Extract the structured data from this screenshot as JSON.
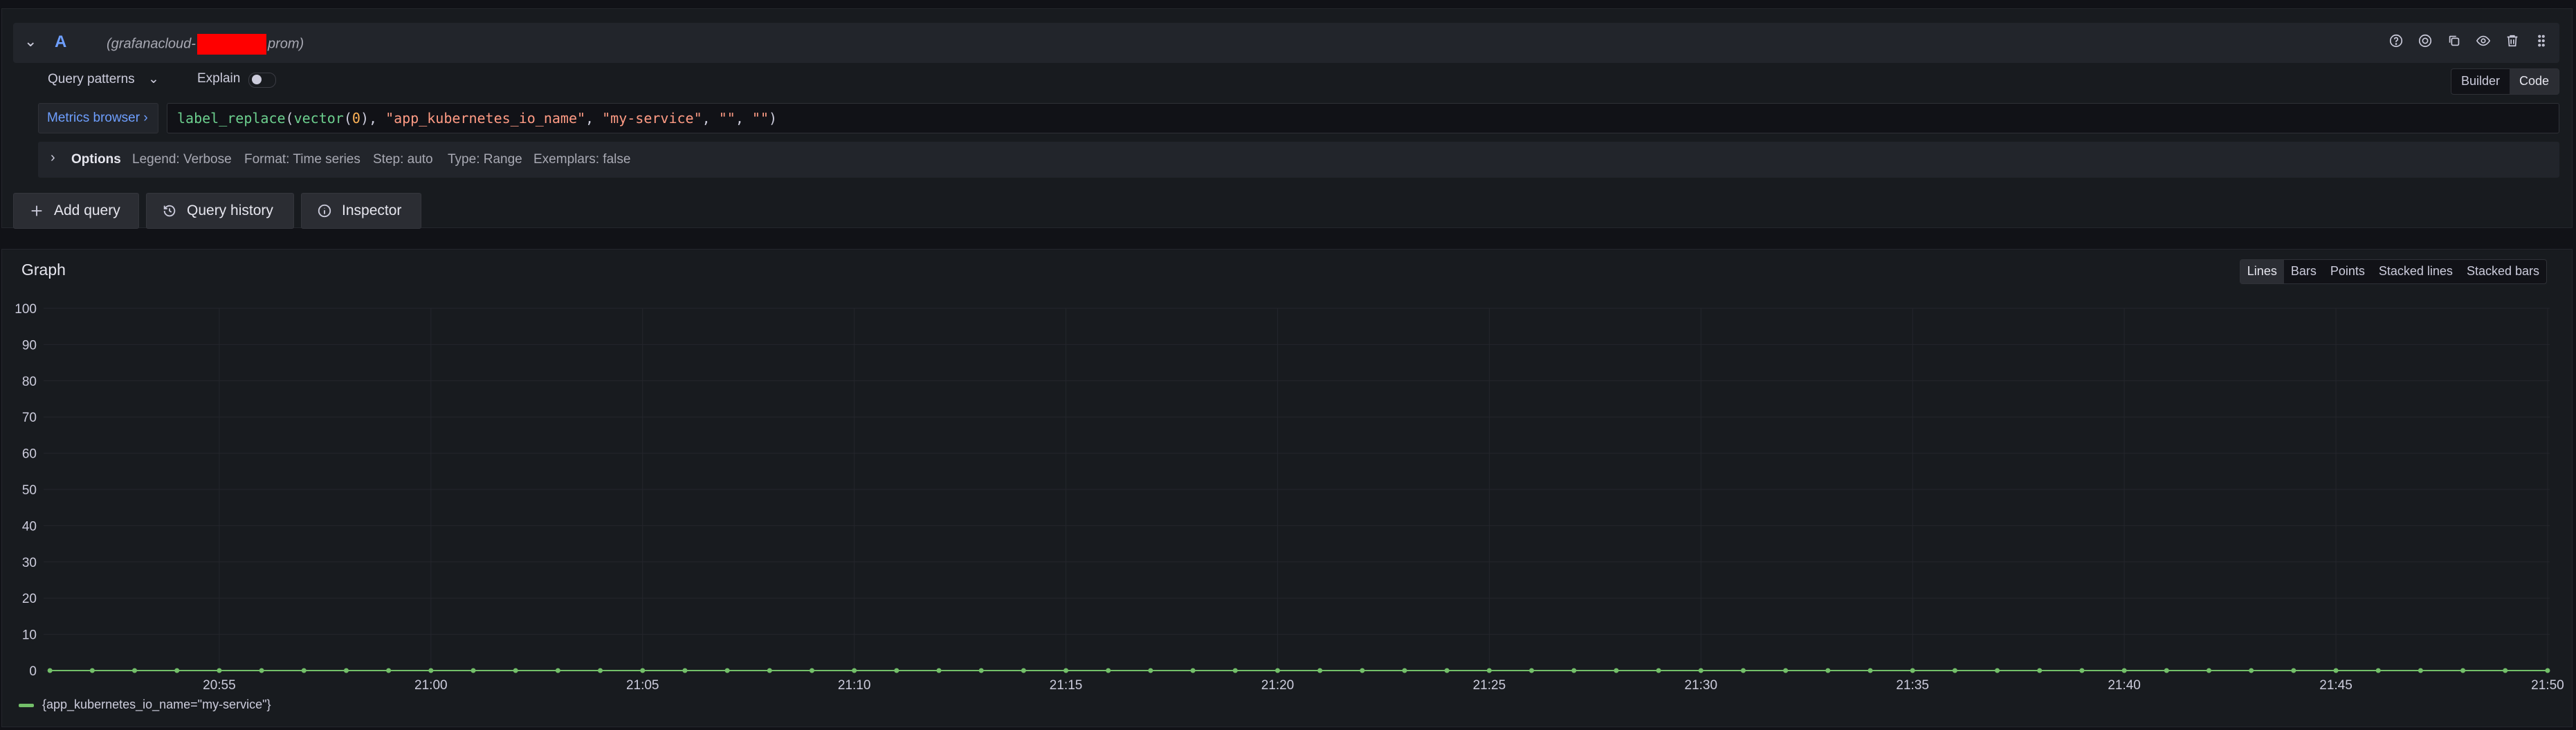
{
  "query": {
    "ref_id": "A",
    "datasource_prefix": "(grafanacloud-",
    "datasource_suffix": "prom)",
    "query_patterns_label": "Query patterns",
    "explain_label": "Explain",
    "mode_builder": "Builder",
    "mode_code": "Code",
    "metrics_browser_label": "Metrics browser",
    "expression": {
      "fn1": "label_replace",
      "fn2": "vector",
      "num": "0",
      "str1": "\"app_kubernetes_io_name\"",
      "str2": "\"my-service\"",
      "str3": "\"\"",
      "str4": "\"\""
    },
    "options": {
      "title": "Options",
      "legend": "Legend: Verbose",
      "format": "Format: Time series",
      "step": "Step: auto",
      "type": "Type: Range",
      "exemplars": "Exemplars: false"
    },
    "icons": [
      "help-icon",
      "query-options-icon",
      "duplicate-icon",
      "eye-icon",
      "trash-icon",
      "drag-handle-icon"
    ]
  },
  "actions": {
    "add_query": "Add query",
    "query_history": "Query history",
    "inspector": "Inspector"
  },
  "graph": {
    "title": "Graph",
    "modes": [
      "Lines",
      "Bars",
      "Points",
      "Stacked lines",
      "Stacked bars"
    ],
    "active_mode": "Lines",
    "legend_label": "{app_kubernetes_io_name=\"my-service\"}"
  },
  "chart_data": {
    "type": "line",
    "title": "Graph",
    "xlabel": "",
    "ylabel": "",
    "ylim": [
      0,
      100
    ],
    "y_ticks": [
      "0",
      "10",
      "20",
      "30",
      "40",
      "50",
      "60",
      "70",
      "80",
      "90",
      "100"
    ],
    "x_ticks": [
      "20:55",
      "21:00",
      "21:05",
      "21:10",
      "21:15",
      "21:20",
      "21:25",
      "21:30",
      "21:35",
      "21:40",
      "21:45",
      "21:50"
    ],
    "series": [
      {
        "name": "{app_kubernetes_io_name=\"my-service\"}",
        "color": "#73bf69",
        "x_start": "20:51",
        "x_end": "21:50",
        "step_minutes": 1,
        "constant_value": 0
      }
    ],
    "grid": true,
    "legend_position": "bottom-left"
  },
  "colors": {
    "background": "#111217",
    "panel": "#181b1f",
    "accent_blue": "#6e9fff",
    "series_green": "#73bf69"
  }
}
